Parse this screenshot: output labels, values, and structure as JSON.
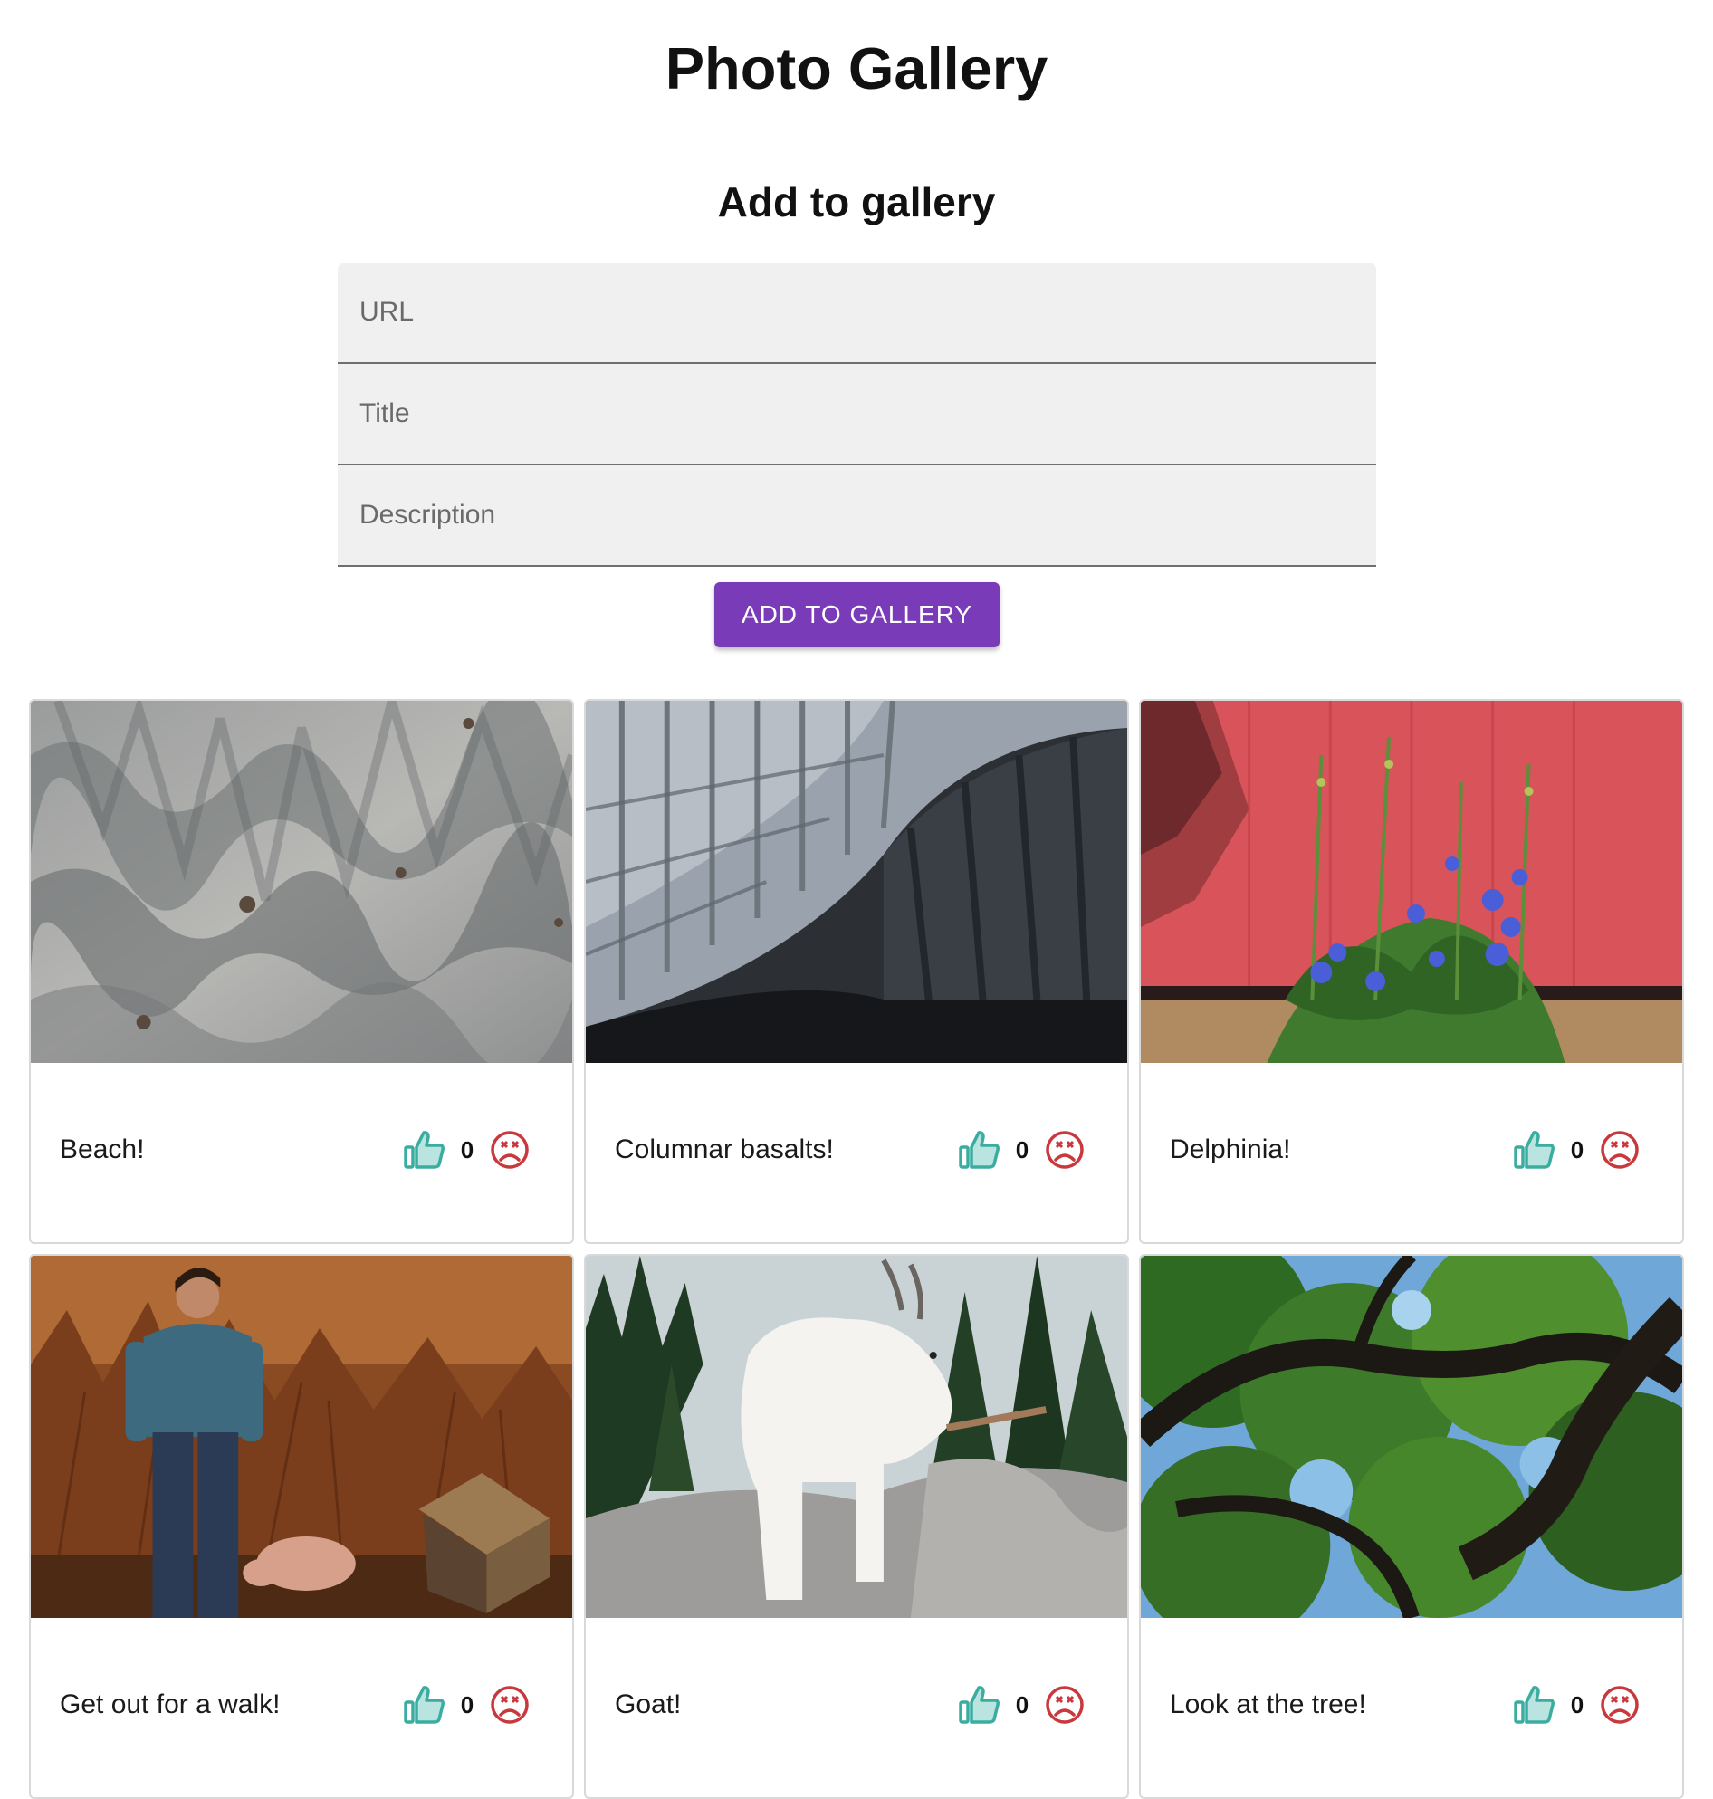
{
  "header": {
    "title": "Photo Gallery"
  },
  "form": {
    "title": "Add to gallery",
    "url_placeholder": "URL",
    "title_placeholder": "Title",
    "description_placeholder": "Description",
    "submit_label": "ADD TO GALLERY"
  },
  "colors": {
    "accent": "#7a3bb8",
    "like": "#3aada0",
    "dislike": "#c8383c"
  },
  "gallery": [
    {
      "title": "Beach!",
      "likes": "0",
      "image": "beach-sand-photo"
    },
    {
      "title": "Columnar basalts!",
      "likes": "0",
      "image": "basalt-cave-photo"
    },
    {
      "title": "Delphinia!",
      "likes": "0",
      "image": "delphinium-flowers-photo"
    },
    {
      "title": "Get out for a walk!",
      "likes": "0",
      "image": "man-with-pig-photo"
    },
    {
      "title": "Goat!",
      "likes": "0",
      "image": "mountain-goat-photo"
    },
    {
      "title": "Look at the tree!",
      "likes": "0",
      "image": "tree-canopy-photo"
    }
  ]
}
